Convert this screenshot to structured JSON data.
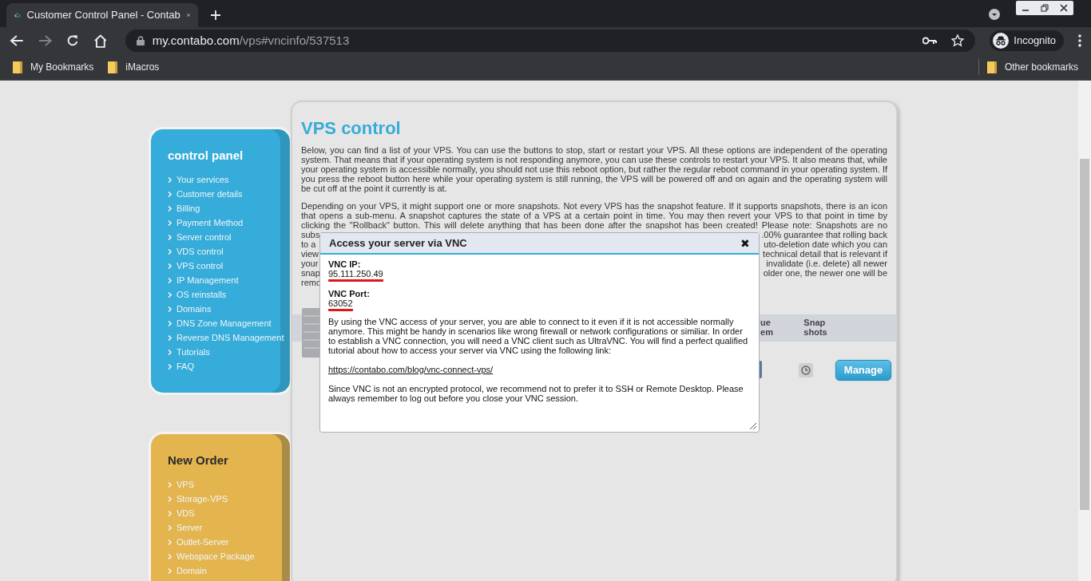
{
  "browser": {
    "tab_title": "Customer Control Panel - Contab",
    "url_host": "my.contabo.com",
    "url_path": "/vps#vncinfo/537513",
    "profile": "Incognito",
    "bookmarks": [
      "My Bookmarks",
      "iMacros"
    ],
    "other_bookmarks": "Other bookmarks"
  },
  "control_panel": {
    "title": "control panel",
    "items": [
      "Your services",
      "Customer details",
      "Billing",
      "Payment Method",
      "Server control",
      "VDS control",
      "VPS control",
      "IP Management",
      "OS reinstalls",
      "Domains",
      "DNS Zone Management",
      "Reverse DNS Management",
      "Tutorials",
      "FAQ"
    ]
  },
  "new_order": {
    "title": "New Order",
    "items": [
      "VPS",
      "Storage-VPS",
      "VDS",
      "Server",
      "Outlet-Server",
      "Webspace Package",
      "Domain"
    ]
  },
  "main": {
    "title": "VPS control",
    "paragraph_1": "Below, you can find a list of your VPS. You can use the buttons to stop, start or restart your VPS. All these options are independent of the operating system. That means that if your operating system is not responding anymore, you can use these controls to restart your VPS. It also means that, while your operating system is accessible normally, you should not use this reboot option, but rather the regular reboot command in your operating system. If you press the reboot button here while your operating system is still running, the VPS will be powered off and on again and the operating system will be cut off at the point it currently is at.",
    "paragraph_2_lines": [
      {
        "left": "Depending on your VPS, it might support one or more snapshots. Not every VPS has the snapshot feature. If it supports snapshots, there is an icon"
      },
      {
        "left": "that opens a sub-menu. A snapshot captures the state of a VPS at a certain point in time. You may then revert your VPS to that point in time by"
      },
      {
        "left": "clicking the \"Rollback\" button. This will delete anything that has been done after the snapshot has been created! Please note: Snapshots are no"
      },
      {
        "left": "subs",
        "right": ".00% guarantee that rolling back"
      },
      {
        "left": "to a",
        "right": "uto-deletion date which you can"
      },
      {
        "left": "view",
        "right": "technical detail that is relevant if"
      },
      {
        "left": "your",
        "right": "invalidate (i.e. delete) all newer"
      },
      {
        "left": "snap",
        "right": "older one, the newer one will be"
      },
      {
        "left": "remo"
      }
    ],
    "table_headers": [
      {
        "lines": [
          "ue",
          "em"
        ]
      },
      {
        "lines": [
          "Snap",
          "shots"
        ]
      }
    ],
    "manage_button": "Manage"
  },
  "modal": {
    "title": "Access your server via VNC",
    "close": "✖",
    "fields": [
      {
        "label": "VNC IP:",
        "value": "95.111.250.49"
      },
      {
        "label": "VNC Port:",
        "value": "63052"
      }
    ],
    "body_1": "By using the VNC access of your server, you are able to connect to it even if it is not accessible normally anymore. This might be handy in scenarios like wrong firewall or network configurations or similiar. In order to establish a VNC connection, you will need a VNC client such as UltraVNC. You will find a perfect qualified tutorial about how to access your server via VNC using the following link:",
    "link": "https://contabo.com/blog/vnc-connect-vps/",
    "body_2": "Since VNC is not an encrypted protocol, we recommend not to prefer it to SSH or Remote Desktop. Please always remember to log out before you close your VNC session."
  }
}
